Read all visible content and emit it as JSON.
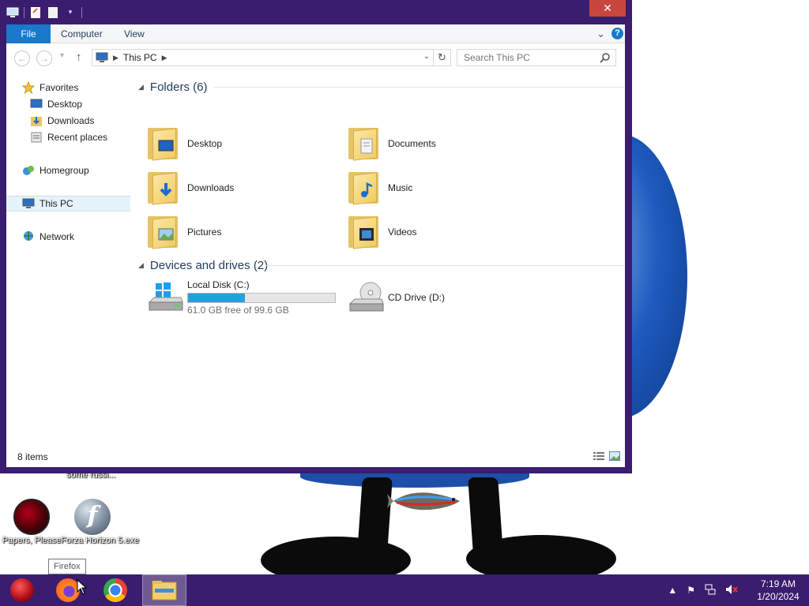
{
  "window": {
    "close_glyph": "✕"
  },
  "ribbon": {
    "tabs": [
      "File",
      "Computer",
      "View"
    ],
    "collapse_glyph": "⌄",
    "help_glyph": "?"
  },
  "address_bar": {
    "path": [
      "This PC"
    ],
    "search_placeholder": "Search This PC"
  },
  "sidebar": {
    "items": [
      {
        "label": "Favorites",
        "icon": "star-icon"
      },
      {
        "label": "Desktop",
        "icon": "desktop-icon"
      },
      {
        "label": "Downloads",
        "icon": "downloads-icon"
      },
      {
        "label": "Recent places",
        "icon": "recent-places-icon"
      },
      {
        "label": "Homegroup",
        "icon": "homegroup-icon"
      },
      {
        "label": "This PC",
        "icon": "computer-icon",
        "selected": true
      },
      {
        "label": "Network",
        "icon": "network-icon"
      }
    ]
  },
  "folders": {
    "heading": "Folders (6)",
    "items": [
      "Desktop",
      "Documents",
      "Downloads",
      "Music",
      "Pictures",
      "Videos"
    ]
  },
  "drives": {
    "heading": "Devices and drives (2)",
    "items": [
      {
        "name": "Local Disk (C:)",
        "free_text": "61.0 GB free of 99.6 GB",
        "used_fraction": 0.388
      },
      {
        "name": "CD Drive (D:)"
      }
    ]
  },
  "status_bar": {
    "item_count": "8 items"
  },
  "desktop": {
    "icons": [
      {
        "label": "Papers, Please"
      },
      {
        "label": "Forza Horizon 5.exe"
      }
    ],
    "partial_label": "some russi...",
    "tooltip": "Firefox"
  },
  "taskbar": {
    "apps": [
      "start-icon",
      "firefox-icon",
      "chrome-icon",
      "file-explorer-icon"
    ],
    "clock_time": "7:19 AM",
    "clock_date": "1/20/2024"
  },
  "colors": {
    "accent": "#1979ca",
    "window_frame": "#3a1d6e",
    "close": "#c7463f",
    "drive_bar": "#26a0da"
  }
}
